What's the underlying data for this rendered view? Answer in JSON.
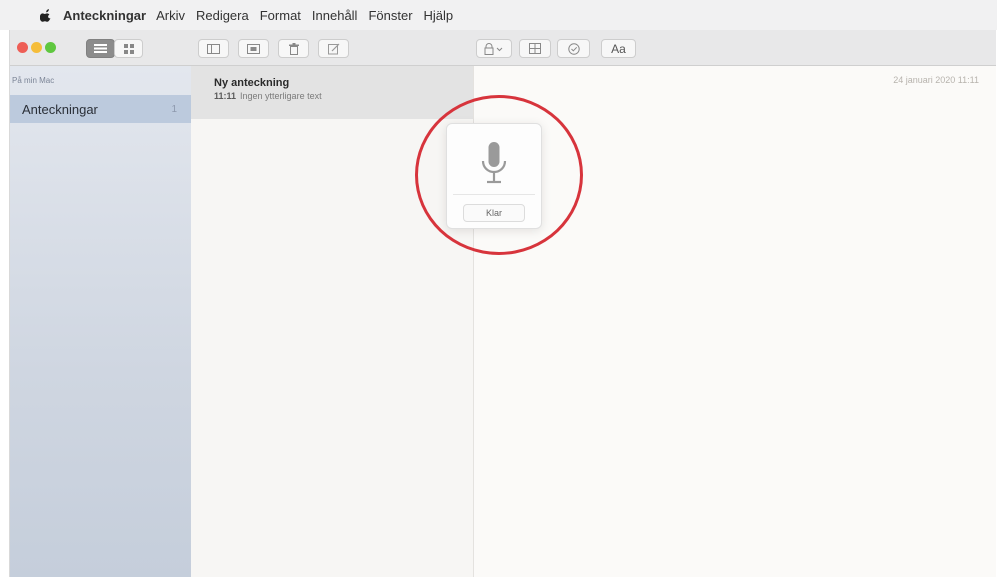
{
  "menubar": {
    "apple_icon": "apple-logo-icon",
    "app_name": "Anteckningar",
    "items": [
      "Arkiv",
      "Redigera",
      "Format",
      "Innehåll",
      "Fönster",
      "Hjälp"
    ]
  },
  "toolbar": {
    "traffic_lights": [
      "#ee5e56",
      "#f5bd3a",
      "#5fc73f"
    ],
    "buttons": [
      "list-view-icon",
      "gallery-view-icon",
      "sidebar-toggle-icon",
      "attachments-icon",
      "trash-icon",
      "compose-icon",
      "lock-icon",
      "table-icon",
      "checklist-icon"
    ],
    "format_label": "Aa"
  },
  "sidebar": {
    "header": "På min Mac",
    "folders": [
      {
        "label": "Anteckningar",
        "count": "1"
      }
    ]
  },
  "notes_list": {
    "notes": [
      {
        "title": "Ny anteckning",
        "time": "11:11",
        "preview": "Ingen ytterligare text"
      }
    ]
  },
  "editor": {
    "date": "24 januari 2020 11:11"
  },
  "dictation": {
    "icon": "microphone-icon",
    "done_label": "Klar",
    "highlight_color": "#d7343c"
  }
}
